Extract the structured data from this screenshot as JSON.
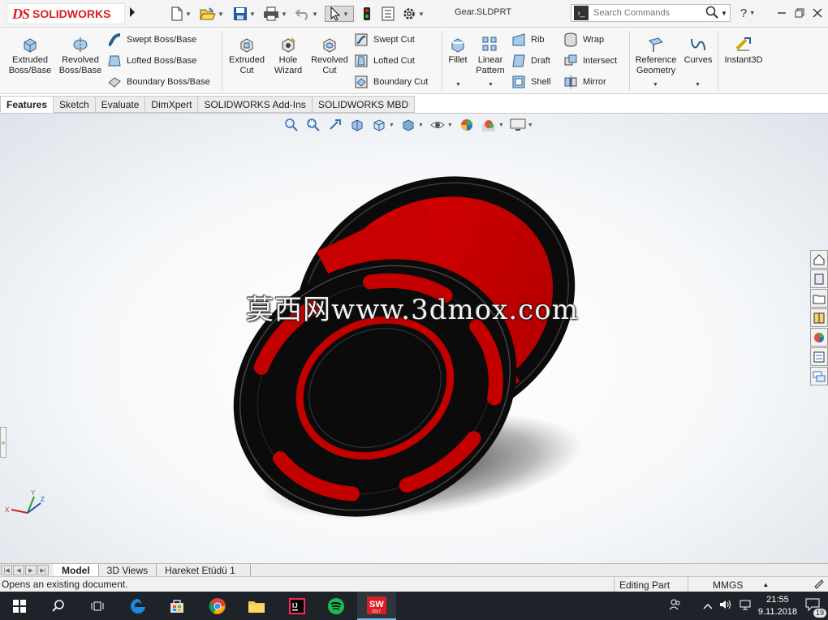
{
  "app": {
    "brand": "SOLIDWORKS",
    "brand_mark": "DS",
    "document_title": "Gear.SLDPRT",
    "accent_color": "#d91f26"
  },
  "quick_access": [
    {
      "name": "new-document-icon"
    },
    {
      "name": "open-document-icon"
    },
    {
      "name": "save-icon"
    },
    {
      "name": "print-icon"
    },
    {
      "name": "undo-icon"
    },
    {
      "name": "select-pointer-icon"
    },
    {
      "name": "rebuild-icon"
    },
    {
      "name": "file-properties-icon"
    },
    {
      "name": "options-gear-icon"
    }
  ],
  "search": {
    "placeholder": "Search Commands"
  },
  "window_controls": {
    "help": "?"
  },
  "ribbon": {
    "extruded_boss": "Extruded\nBoss/Base",
    "revolved_boss": "Revolved\nBoss/Base",
    "swept_boss": "Swept Boss/Base",
    "lofted_boss": "Lofted Boss/Base",
    "boundary_boss": "Boundary Boss/Base",
    "extruded_cut": "Extruded\nCut",
    "hole_wizard": "Hole\nWizard",
    "revolved_cut": "Revolved\nCut",
    "swept_cut": "Swept Cut",
    "lofted_cut": "Lofted Cut",
    "boundary_cut": "Boundary Cut",
    "fillet": "Fillet",
    "linear_pattern": "Linear\nPattern",
    "rib": "Rib",
    "draft": "Draft",
    "shell": "Shell",
    "wrap": "Wrap",
    "intersect": "Intersect",
    "mirror": "Mirror",
    "reference_geometry": "Reference\nGeometry",
    "curves": "Curves",
    "instant3d": "Instant3D"
  },
  "tabs": [
    "Features",
    "Sketch",
    "Evaluate",
    "DimXpert",
    "SOLIDWORKS Add-Ins",
    "SOLIDWORKS MBD"
  ],
  "active_tab": "Features",
  "viewport": {
    "watermark": "莫西网www.3dmox.com",
    "model_colors": {
      "flange": "#111111",
      "body": "#d30000"
    },
    "triad_labels": {
      "x": "X",
      "y": "Y",
      "z": "Z"
    }
  },
  "bottom_tabs": [
    "Model",
    "3D Views",
    "Hareket Etüdü 1"
  ],
  "active_bottom_tab": "Model",
  "status": {
    "message": "Opens an existing document.",
    "mode": "Editing Part",
    "units": "MMGS"
  },
  "taskbar": {
    "time": "21:55",
    "date": "9.11.2018",
    "notification_count": "19",
    "sw_label": "SW",
    "sw_version": "2017"
  }
}
